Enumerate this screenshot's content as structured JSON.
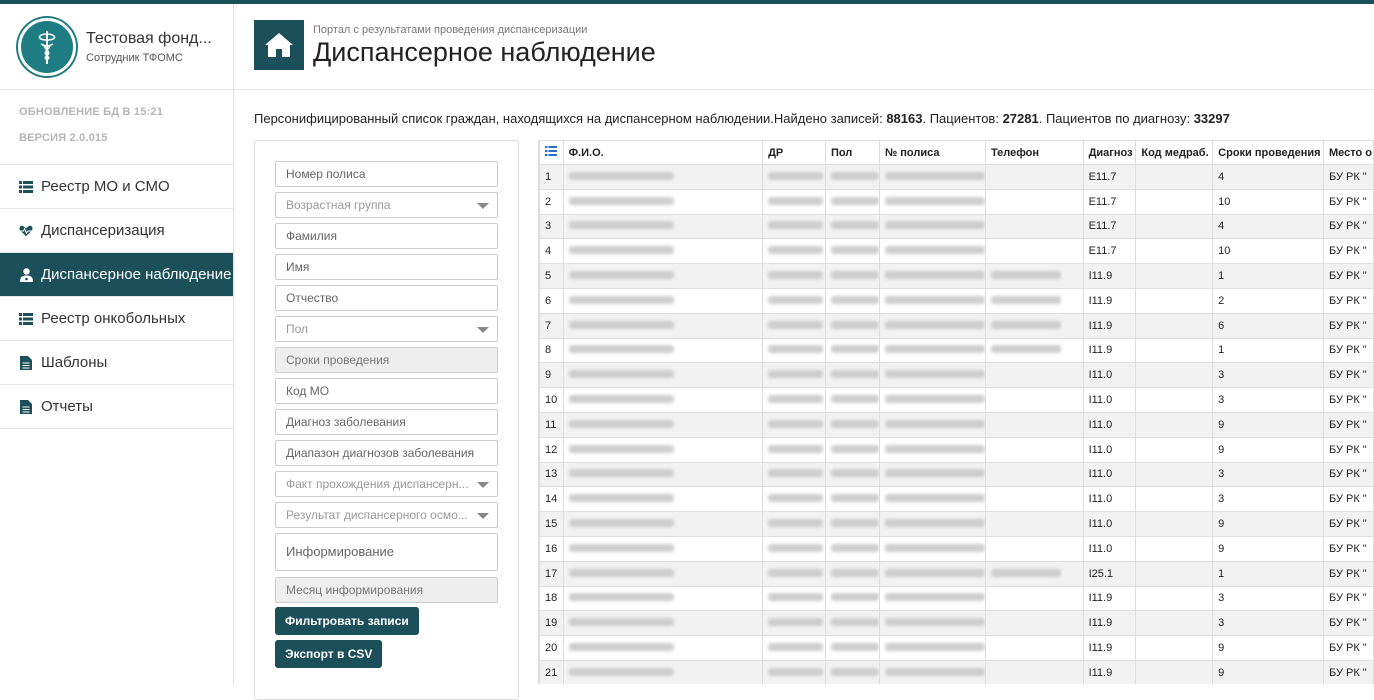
{
  "app": {
    "org_name": "Тестовая фонд...",
    "role": "Сотрудник ТФОМС",
    "db_update": "ОБНОВЛЕНИЕ БД В 15:21",
    "version": "ВЕРСИЯ 2.0.015"
  },
  "nav": [
    {
      "label": "Реестр МО и СМО",
      "icon": "list-icon",
      "active": false
    },
    {
      "label": "Диспансеризация",
      "icon": "heartbeat-icon",
      "active": false
    },
    {
      "label": "Диспансерное наблюдение",
      "icon": "user-md-icon",
      "active": true
    },
    {
      "label": "Реестр онкобольных",
      "icon": "list-icon",
      "active": false
    },
    {
      "label": "Шаблоны",
      "icon": "file-icon",
      "active": false
    },
    {
      "label": "Отчеты",
      "icon": "file-icon",
      "active": false
    }
  ],
  "header": {
    "breadcrumb": "Портал с результатами проведения диспансеризации",
    "title": "Диспансерное наблюдение"
  },
  "summary": {
    "prefix": "Персонифицированный список граждан, находящихся на диспансерном наблюдении.Найдено записей: ",
    "records": "88163",
    "patients_label": ". Пациентов: ",
    "patients": "27281",
    "by_diag_label": ". Пациентов по диагнозу: ",
    "by_diag": "33297"
  },
  "filters": {
    "policy": "Номер полиса",
    "age_group": "Возрастная группа",
    "surname": "Фамилия",
    "name": "Имя",
    "patronymic": "Отчество",
    "sex": "Пол",
    "terms": "Сроки проведения",
    "mo_code": "Код МО",
    "diagnosis": "Диагноз заболевания",
    "diagnosis_range": "Диапазон диагнозов заболевания",
    "fact": "Факт прохождения диспансерн...",
    "result": "Результат диспансерного осмо...",
    "informing": "Информирование",
    "inform_month": "Месяц информирования",
    "filter_button": "Фильтровать записи",
    "export_button": "Экспорт в CSV"
  },
  "table": {
    "columns": [
      "Ф.И.О.",
      "ДР",
      "Пол",
      "№ полиса",
      "Телефон",
      "Диагноз",
      "Код медраб.",
      "Сроки проведения",
      "Место о"
    ],
    "rows": [
      {
        "n": "1",
        "diag": "E11.7",
        "term": "4",
        "place": "БУ РК \"",
        "phone": false
      },
      {
        "n": "2",
        "diag": "E11.7",
        "term": "10",
        "place": "БУ РК \"",
        "phone": false
      },
      {
        "n": "3",
        "diag": "E11.7",
        "term": "4",
        "place": "БУ РК \"",
        "phone": false
      },
      {
        "n": "4",
        "diag": "E11.7",
        "term": "10",
        "place": "БУ РК \"",
        "phone": false
      },
      {
        "n": "5",
        "diag": "I11.9",
        "term": "1",
        "place": "БУ РК \"",
        "phone": true
      },
      {
        "n": "6",
        "diag": "I11.9",
        "term": "2",
        "place": "БУ РК \"",
        "phone": true
      },
      {
        "n": "7",
        "diag": "I11.9",
        "term": "6",
        "place": "БУ РК \"",
        "phone": true
      },
      {
        "n": "8",
        "diag": "I11.9",
        "term": "1",
        "place": "БУ РК \"",
        "phone": true
      },
      {
        "n": "9",
        "diag": "I11.0",
        "term": "3",
        "place": "БУ РК \"",
        "phone": false
      },
      {
        "n": "10",
        "diag": "I11.0",
        "term": "3",
        "place": "БУ РК \"",
        "phone": false
      },
      {
        "n": "11",
        "diag": "I11.0",
        "term": "9",
        "place": "БУ РК \"",
        "phone": false
      },
      {
        "n": "12",
        "diag": "I11.0",
        "term": "9",
        "place": "БУ РК \"",
        "phone": false
      },
      {
        "n": "13",
        "diag": "I11.0",
        "term": "3",
        "place": "БУ РК \"",
        "phone": false
      },
      {
        "n": "14",
        "diag": "I11.0",
        "term": "3",
        "place": "БУ РК \"",
        "phone": false
      },
      {
        "n": "15",
        "diag": "I11.0",
        "term": "9",
        "place": "БУ РК \"",
        "phone": false
      },
      {
        "n": "16",
        "diag": "I11.0",
        "term": "9",
        "place": "БУ РК \"",
        "phone": false
      },
      {
        "n": "17",
        "diag": "I25.1",
        "term": "1",
        "place": "БУ РК \"",
        "phone": true
      },
      {
        "n": "18",
        "diag": "I11.9",
        "term": "3",
        "place": "БУ РК \"",
        "phone": false
      },
      {
        "n": "19",
        "diag": "I11.9",
        "term": "3",
        "place": "БУ РК \"",
        "phone": false
      },
      {
        "n": "20",
        "diag": "I11.9",
        "term": "9",
        "place": "БУ РК \"",
        "phone": false
      },
      {
        "n": "21",
        "diag": "I11.9",
        "term": "9",
        "place": "БУ РК \"",
        "phone": false
      }
    ]
  }
}
